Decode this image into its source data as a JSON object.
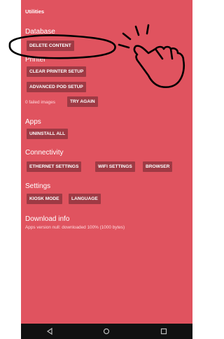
{
  "app": {
    "title": "Utilities"
  },
  "sections": {
    "database": {
      "title": "Database",
      "delete_content": "DELETE CONTENT"
    },
    "printer": {
      "title": "Printer",
      "clear_setup": "CLEAR PRINTER SETUP",
      "advanced_pod": "ADVANCED POD SETUP",
      "failed_images": "0 failed images",
      "try_again": "TRY AGAIN"
    },
    "apps": {
      "title": "Apps",
      "uninstall_all": "UNINSTALL ALL"
    },
    "connectivity": {
      "title": "Connectivity",
      "ethernet": "ETHERNET SETTINGS",
      "wifi": "WIFI SETTINGS",
      "browser": "BROWSER"
    },
    "settings": {
      "title": "Settings",
      "kiosk": "KIOSK MODE",
      "language": "LANGUAGE"
    },
    "download": {
      "title": "Download info",
      "status": "Apps version null: downloaded 100% (1000 bytes)"
    }
  },
  "navbar": {
    "back": "back-icon",
    "home": "home-icon",
    "recents": "recents-icon"
  },
  "colors": {
    "screen_bg": "#e0535f",
    "button_bg": "#9e3a44",
    "navbar_bg": "#111111"
  },
  "annotation": {
    "type": "hand-drawn circle and pointing hand",
    "target": "delete_content"
  }
}
